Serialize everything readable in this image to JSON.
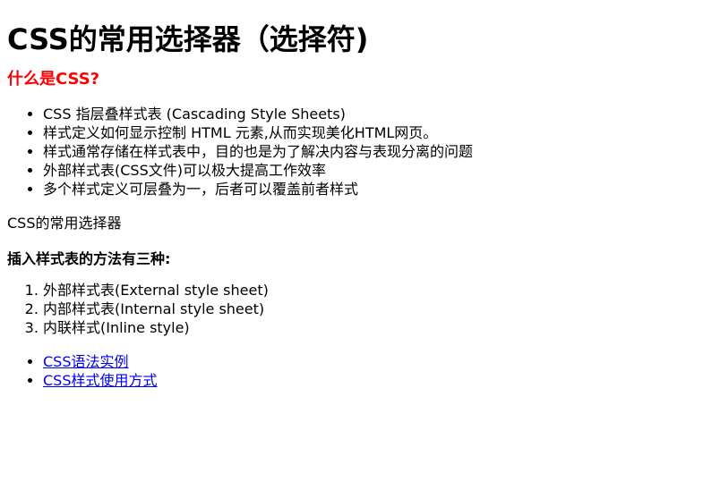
{
  "page_title": "CSS的常用选择器（选择符)",
  "what_is": {
    "heading": "什么是CSS?",
    "heading_color": "#ff0000",
    "items": [
      "CSS 指层叠样式表 (Cascading Style Sheets)",
      "样式定义如何显示控制 HTML 元素,从而实现美化HTML网页。",
      "样式通常存储在样式表中，目的也是为了解决内容与表现分离的问题",
      "外部样式表(CSS文件)可以极大提高工作效率",
      "多个样式定义可层叠为一，后者可以覆盖前者样式"
    ]
  },
  "selectors_text": "CSS的常用选择器",
  "methods": {
    "title": "插入样式表的方法有三种:",
    "items": [
      "外部样式表(External style sheet)",
      "内部样式表(Internal style sheet)",
      "内联样式(Inline style)"
    ]
  },
  "links": [
    "CSS语法实例",
    "CSS样式使用方式"
  ],
  "link_color": "#0000ee"
}
